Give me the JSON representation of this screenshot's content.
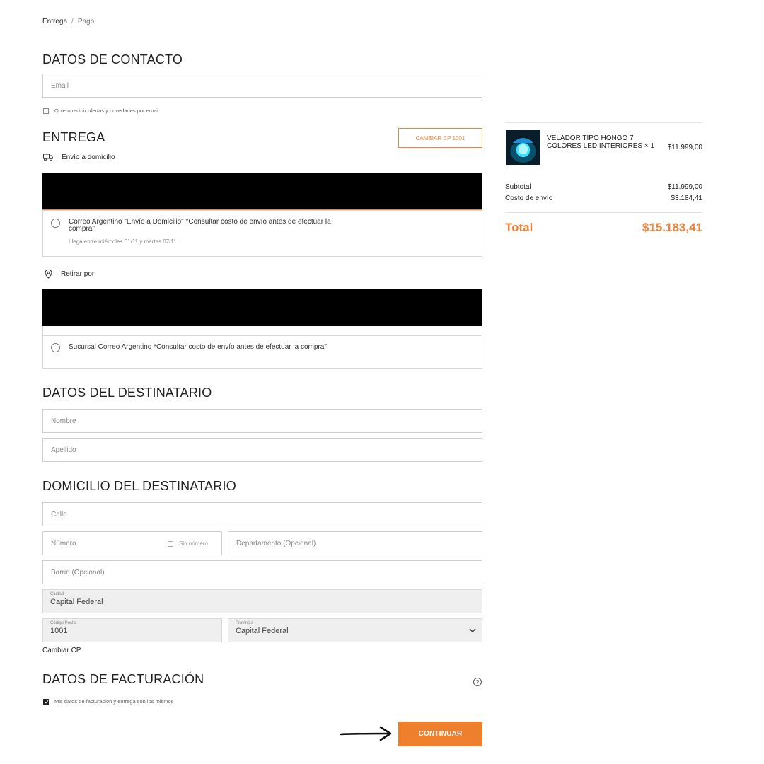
{
  "breadcrumb": {
    "current": "Entrega",
    "separator": "/",
    "next": "Pago"
  },
  "contact": {
    "title": "DATOS DE CONTACTO",
    "email_placeholder": "Email",
    "newsletter_label": "Quiero recibir ofertas y novedades por email"
  },
  "delivery": {
    "title": "ENTREGA",
    "change_cp_button": "CAMBIAR CP 1001",
    "home_label": "Envío a domicilio",
    "home_option": {
      "title": "Correo Argentino \"Envío a Domicilio\" *Consultar costo de envío antes de efectuar la compra\"",
      "subtitle": "Llega entre miércoles 01/11 y martes 07/11"
    },
    "pickup_label": "Retirar por",
    "pickup_option": {
      "title": "Sucursal Correo Argentino *Consultar costo de envío antes de efectuar la compra\""
    }
  },
  "recipient": {
    "title": "DATOS DEL DESTINATARIO",
    "first_name_placeholder": "Nombre",
    "last_name_placeholder": "Apellido"
  },
  "address": {
    "title": "DOMICILIO DEL DESTINATARIO",
    "street_placeholder": "Calle",
    "number_placeholder": "Número",
    "no_number_label": "Sin número",
    "apartment_placeholder": "Departamento (Opcional)",
    "neighborhood_placeholder": "Barrio (Opcional)",
    "city_label": "Ciudad",
    "city_value": "Capital Federal",
    "postal_label": "Código Postal",
    "postal_value": "1001",
    "province_label": "Provincia",
    "province_value": "Capital Federal",
    "change_cp_link": "Cambiar CP"
  },
  "billing": {
    "title": "DATOS DE FACTURACIÓN",
    "help_icon": "?",
    "same_data_label": "Mis datos de facturación y entrega son los mismos"
  },
  "continue_button": "CONTINUAR",
  "cart": {
    "item": {
      "name": "VELADOR TIPO HONGO 7 COLORES LED INTERIORES × 1",
      "price": "$11.999,00"
    },
    "subtotal_label": "Subtotal",
    "subtotal_value": "$11.999,00",
    "shipping_label": "Costo de envío",
    "shipping_value": "$3.184,41",
    "total_label": "Total",
    "total_value": "$15.183,41"
  },
  "colors": {
    "accent": "#ee7f2d",
    "total": "#f0833a",
    "border": "#cfcfcf",
    "readonly_bg": "#efefef"
  }
}
